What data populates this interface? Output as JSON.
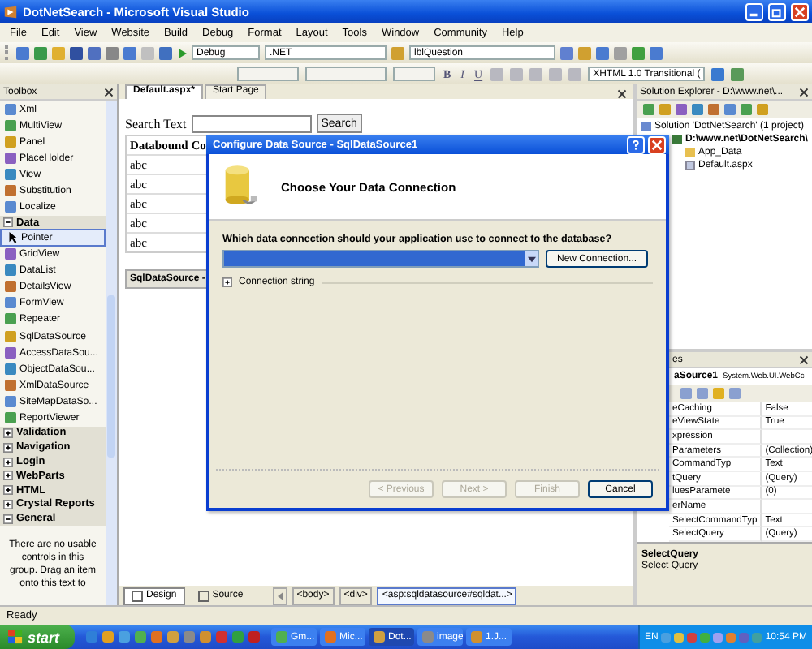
{
  "window": {
    "title": "DotNetSearch - Microsoft Visual Studio"
  },
  "menu": [
    "File",
    "Edit",
    "View",
    "Website",
    "Build",
    "Debug",
    "Format",
    "Layout",
    "Tools",
    "Window",
    "Community",
    "Help"
  ],
  "toolbar": {
    "configuration": "Debug",
    "platform": ".NET",
    "control": "lblQuestion"
  },
  "format_toolbar": {
    "bold": "B",
    "italic": "I",
    "underline": "U",
    "doctype": "XHTML 1.0 Transitional ("
  },
  "toolbox": {
    "title": "Toolbox",
    "items": [
      {
        "kind": "item",
        "label": "Xml",
        "selected": false
      },
      {
        "kind": "item",
        "label": "MultiView",
        "selected": false
      },
      {
        "kind": "item",
        "label": "Panel",
        "selected": false
      },
      {
        "kind": "item",
        "label": "PlaceHolder",
        "selected": false
      },
      {
        "kind": "item",
        "label": "View",
        "selected": false
      },
      {
        "kind": "item",
        "label": "Substitution",
        "selected": false
      },
      {
        "kind": "item",
        "label": "Localize",
        "selected": false
      },
      {
        "kind": "section",
        "label": "Data",
        "expanded": true
      },
      {
        "kind": "pointer",
        "label": "Pointer",
        "selected": true
      },
      {
        "kind": "item",
        "label": "GridView",
        "selected": false
      },
      {
        "kind": "item",
        "label": "DataList",
        "selected": false
      },
      {
        "kind": "item",
        "label": "DetailsView",
        "selected": false
      },
      {
        "kind": "item",
        "label": "FormView",
        "selected": false
      },
      {
        "kind": "item",
        "label": "Repeater",
        "selected": false
      },
      {
        "kind": "item",
        "label": "SqlDataSource",
        "selected": false
      },
      {
        "kind": "item",
        "label": "AccessDataSou...",
        "selected": false
      },
      {
        "kind": "item",
        "label": "ObjectDataSou...",
        "selected": false
      },
      {
        "kind": "item",
        "label": "XmlDataSource",
        "selected": false
      },
      {
        "kind": "item",
        "label": "SiteMapDataSo...",
        "selected": false
      },
      {
        "kind": "item",
        "label": "ReportViewer",
        "selected": false
      },
      {
        "kind": "section",
        "label": "Validation",
        "expanded": false
      },
      {
        "kind": "section",
        "label": "Navigation",
        "expanded": false
      },
      {
        "kind": "section",
        "label": "Login",
        "expanded": false
      },
      {
        "kind": "section",
        "label": "WebParts",
        "expanded": false
      },
      {
        "kind": "section",
        "label": "HTML",
        "expanded": false
      },
      {
        "kind": "section",
        "label": "Crystal Reports",
        "expanded": false
      },
      {
        "kind": "section",
        "label": "General",
        "expanded": true
      }
    ],
    "empty_message": "There are no usable controls in this group. Drag an item onto this text to"
  },
  "document_tabs": [
    {
      "label": "Default.aspx*",
      "selected": true
    },
    {
      "label": "Start Page",
      "selected": false
    }
  ],
  "design": {
    "search_label": "Search Text",
    "search_button": "Search",
    "grid_header": "Databound Co",
    "grid_rows": [
      "abc",
      "abc",
      "abc",
      "abc",
      "abc"
    ],
    "datasource": "SqlDataSource - "
  },
  "view_tabs": [
    {
      "label": "Design",
      "selected": true
    },
    {
      "label": "Source",
      "selected": false
    }
  ],
  "breadcrumbs": [
    {
      "label": "<body>",
      "selected": false
    },
    {
      "label": "<div>",
      "selected": false
    },
    {
      "label": "<asp:sqldatasource#sqldat...>",
      "selected": true
    }
  ],
  "solution_explorer": {
    "title": "Solution Explorer - D:\\www.net\\...",
    "tree": [
      {
        "kind": "solution",
        "label": "Solution 'DotNetSearch' (1 project)",
        "children": [
          {
            "kind": "project",
            "label": "D:\\www.net\\DotNetSearch\\",
            "children": [
              {
                "kind": "folder",
                "label": "App_Data"
              },
              {
                "kind": "file",
                "label": "Default.aspx"
              }
            ]
          }
        ]
      }
    ]
  },
  "properties": {
    "title": "es",
    "object_name": "aSource1",
    "object_type": "System.Web.UI.WebCc",
    "rows": [
      {
        "name": "eCaching",
        "value": "False"
      },
      {
        "name": "eViewState",
        "value": "True"
      },
      {
        "name": "xpression"
      },
      {
        "name": "Parameters",
        "value": "(Collection)"
      },
      {
        "name": "CommandTyp",
        "value": "Text"
      },
      {
        "name": "tQuery",
        "value": "(Query)"
      },
      {
        "name": "luesParamete",
        "value": "(0)"
      },
      {
        "name": "erName"
      },
      {
        "name": "SelectCommandTyp",
        "value": "Text"
      },
      {
        "name": "SelectQuery",
        "value": "(Query)"
      }
    ],
    "description_title": "SelectQuery",
    "description": "Select Query"
  },
  "dialog": {
    "title": "Configure Data Source - SqlDataSource1",
    "heading": "Choose Your Data Connection",
    "question": "Which data connection should your application use to connect to the database?",
    "new_connection": "New Connection...",
    "expander": "Connection string",
    "buttons": [
      {
        "label": "< Previous",
        "disabled": true
      },
      {
        "label": "Next >",
        "disabled": true
      },
      {
        "label": "Finish",
        "disabled": true
      },
      {
        "label": "Cancel",
        "disabled": false
      }
    ]
  },
  "status_bar": "Ready",
  "taskbar": {
    "start": "start",
    "tasks": [
      {
        "label": "Gm...",
        "selected": false
      },
      {
        "label": "Mic...",
        "selected": false
      },
      {
        "label": "Dot...",
        "selected": true
      },
      {
        "label": "image",
        "selected": false
      },
      {
        "label": "1.J...",
        "selected": false
      }
    ],
    "language": "EN",
    "time": "10:54 PM"
  }
}
